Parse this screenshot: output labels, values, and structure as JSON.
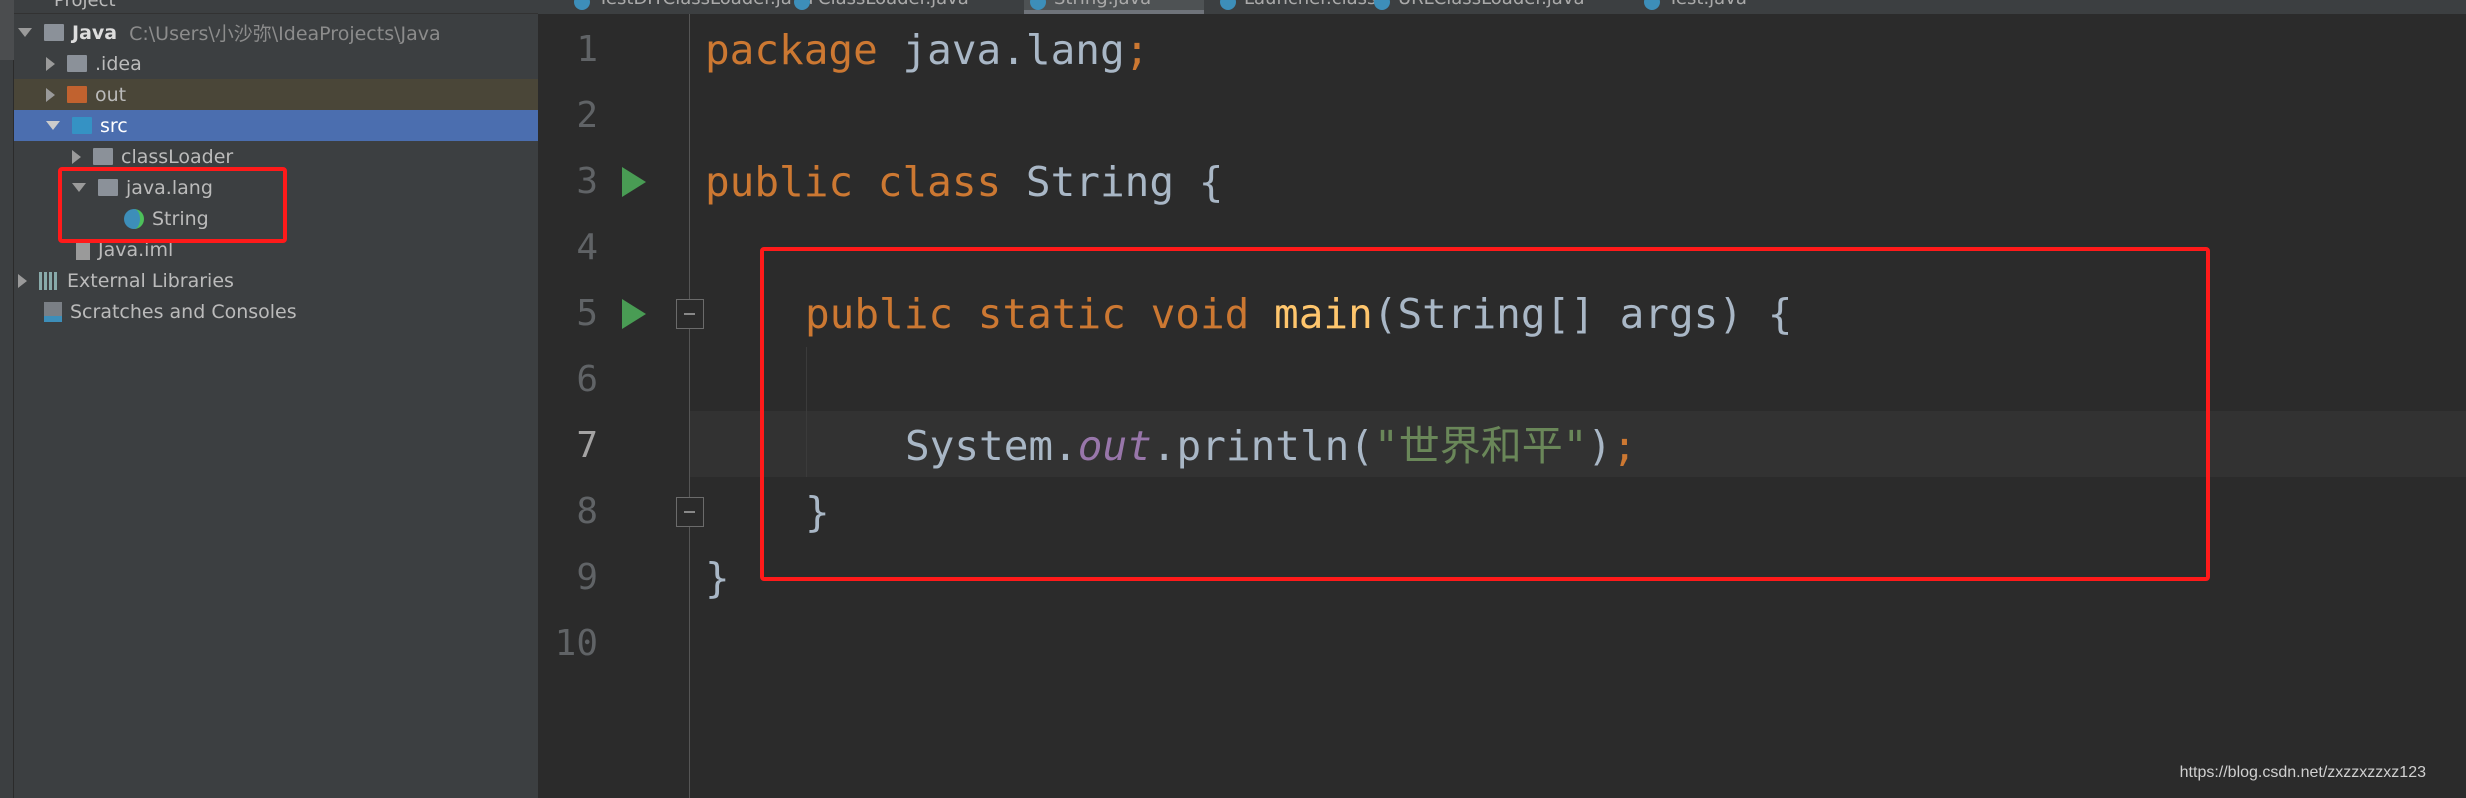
{
  "sidebar": {
    "header": "Project",
    "tree": [
      {
        "label": "Java",
        "path": "C:\\Users\\小沙弥\\IdeaProjects\\Java"
      },
      {
        "label": ".idea"
      },
      {
        "label": "out"
      },
      {
        "label": "src"
      },
      {
        "label": "classLoader"
      },
      {
        "label": "java.lang"
      },
      {
        "label": "String"
      },
      {
        "label": "Java.iml"
      },
      {
        "label": "External Libraries"
      },
      {
        "label": "Scratches and Consoles"
      }
    ]
  },
  "tabs": [
    "TestDIYClassLoader.java",
    "ClassLoader.java",
    "String.java",
    "Launcher.class",
    "URLClassLoader.java",
    "Test.java"
  ],
  "editor": {
    "line_numbers": [
      "1",
      "2",
      "3",
      "4",
      "5",
      "6",
      "7",
      "8",
      "9",
      "10"
    ],
    "l1": {
      "kw": "package",
      "rest": " java.lang",
      "semi": ";"
    },
    "l3": {
      "kw": "public class",
      "rest": " String {"
    },
    "l5": {
      "kw": "public static void",
      "fn": "main",
      "rest": "(String[] args) {"
    },
    "l7": {
      "a": "System.",
      "b": "out",
      "c": ".println(",
      "s": "\"世界和平\"",
      "d": ")",
      "semi": ";"
    },
    "l8": "}",
    "l9": "}"
  },
  "watermark": "https://blog.csdn.net/zxzzxzzxz123",
  "colors": {
    "keyword": "#cc7832",
    "string": "#6a8759",
    "function": "#ffc66d",
    "highlight": "#ff1a1a",
    "selection": "#4b6eaf"
  }
}
